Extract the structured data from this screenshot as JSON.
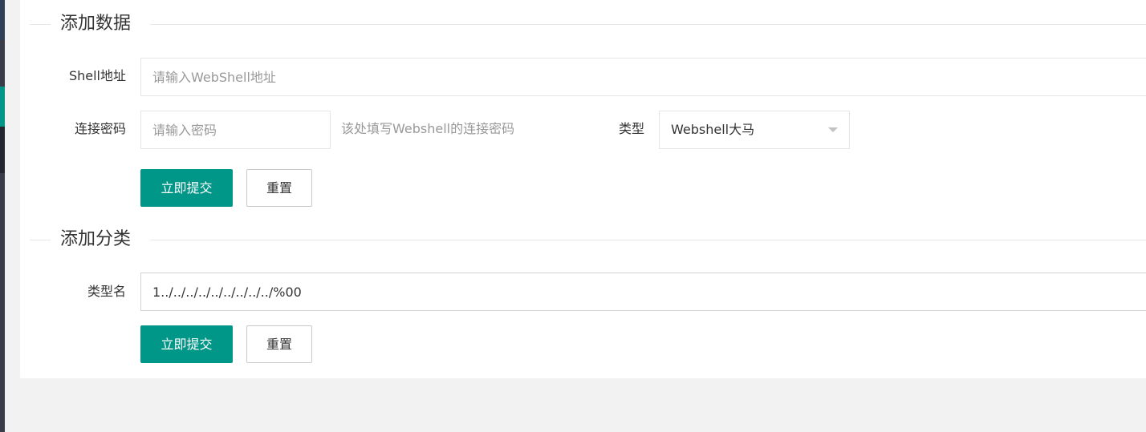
{
  "colors": {
    "primary": "#009688",
    "sidebar": "#393D49"
  },
  "section_add_data": {
    "legend": "添加数据",
    "shell_label": "Shell地址",
    "shell_placeholder": "请输入WebShell地址",
    "password_label": "连接密码",
    "password_placeholder": "请输入密码",
    "password_hint": "该处填写Webshell的连接密码",
    "type_label": "类型",
    "type_selected": "Webshell大马",
    "submit_label": "立即提交",
    "reset_label": "重置"
  },
  "section_add_category": {
    "legend": "添加分类",
    "name_label": "类型名",
    "name_value": "1../../../../../../../../../%00",
    "submit_label": "立即提交",
    "reset_label": "重置"
  }
}
